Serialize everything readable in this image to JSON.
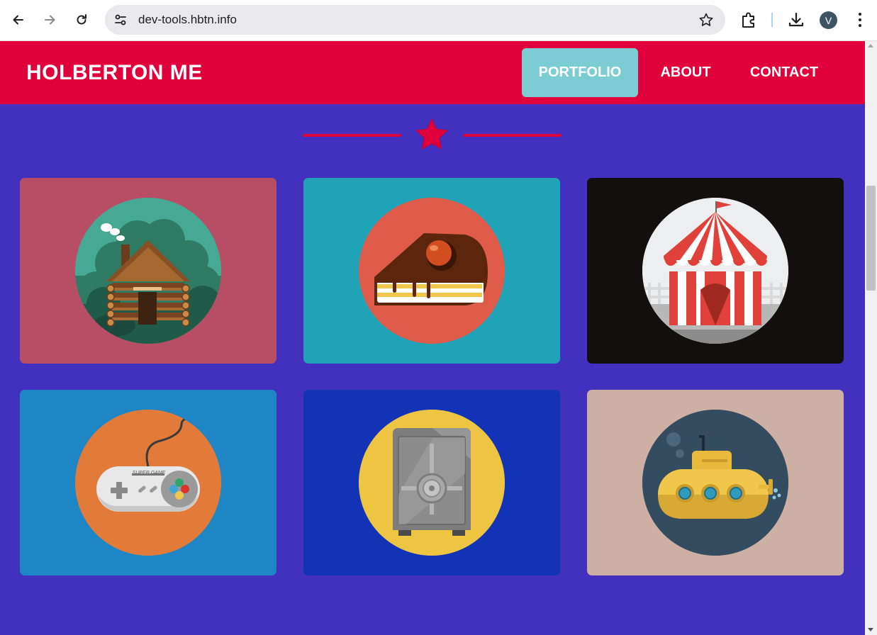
{
  "browser": {
    "url": "dev-tools.hbtn.info",
    "profile_initial": "V"
  },
  "site": {
    "brand": "HOLBERTON ME",
    "nav": [
      {
        "label": "PORTFOLIO",
        "active": true
      },
      {
        "label": "ABOUT",
        "active": false
      },
      {
        "label": "CONTACT",
        "active": false
      }
    ]
  },
  "portfolio": {
    "items": [
      {
        "icon": "log-cabin-icon",
        "bg": "#b84e65",
        "circle": "#46a994"
      },
      {
        "icon": "cake-slice-icon",
        "bg": "#20a3b6",
        "circle": "#e05c4a"
      },
      {
        "icon": "circus-tent-icon",
        "bg": "#130f0f",
        "circle": "#eceeef"
      },
      {
        "icon": "game-controller-icon",
        "bg": "#1e86c4",
        "circle": "#e27b3a"
      },
      {
        "icon": "safe-icon",
        "bg": "#1233b6",
        "circle": "#eec542"
      },
      {
        "icon": "submarine-icon",
        "bg": "#cdb0a3",
        "circle": "#344c5f"
      }
    ],
    "controller_text": "SUPER GAME"
  },
  "colors": {
    "page_bg": "#4230bf",
    "header_bg": "#e0003b",
    "active_nav_bg": "#7ccdd3",
    "accent": "#e0003b"
  }
}
